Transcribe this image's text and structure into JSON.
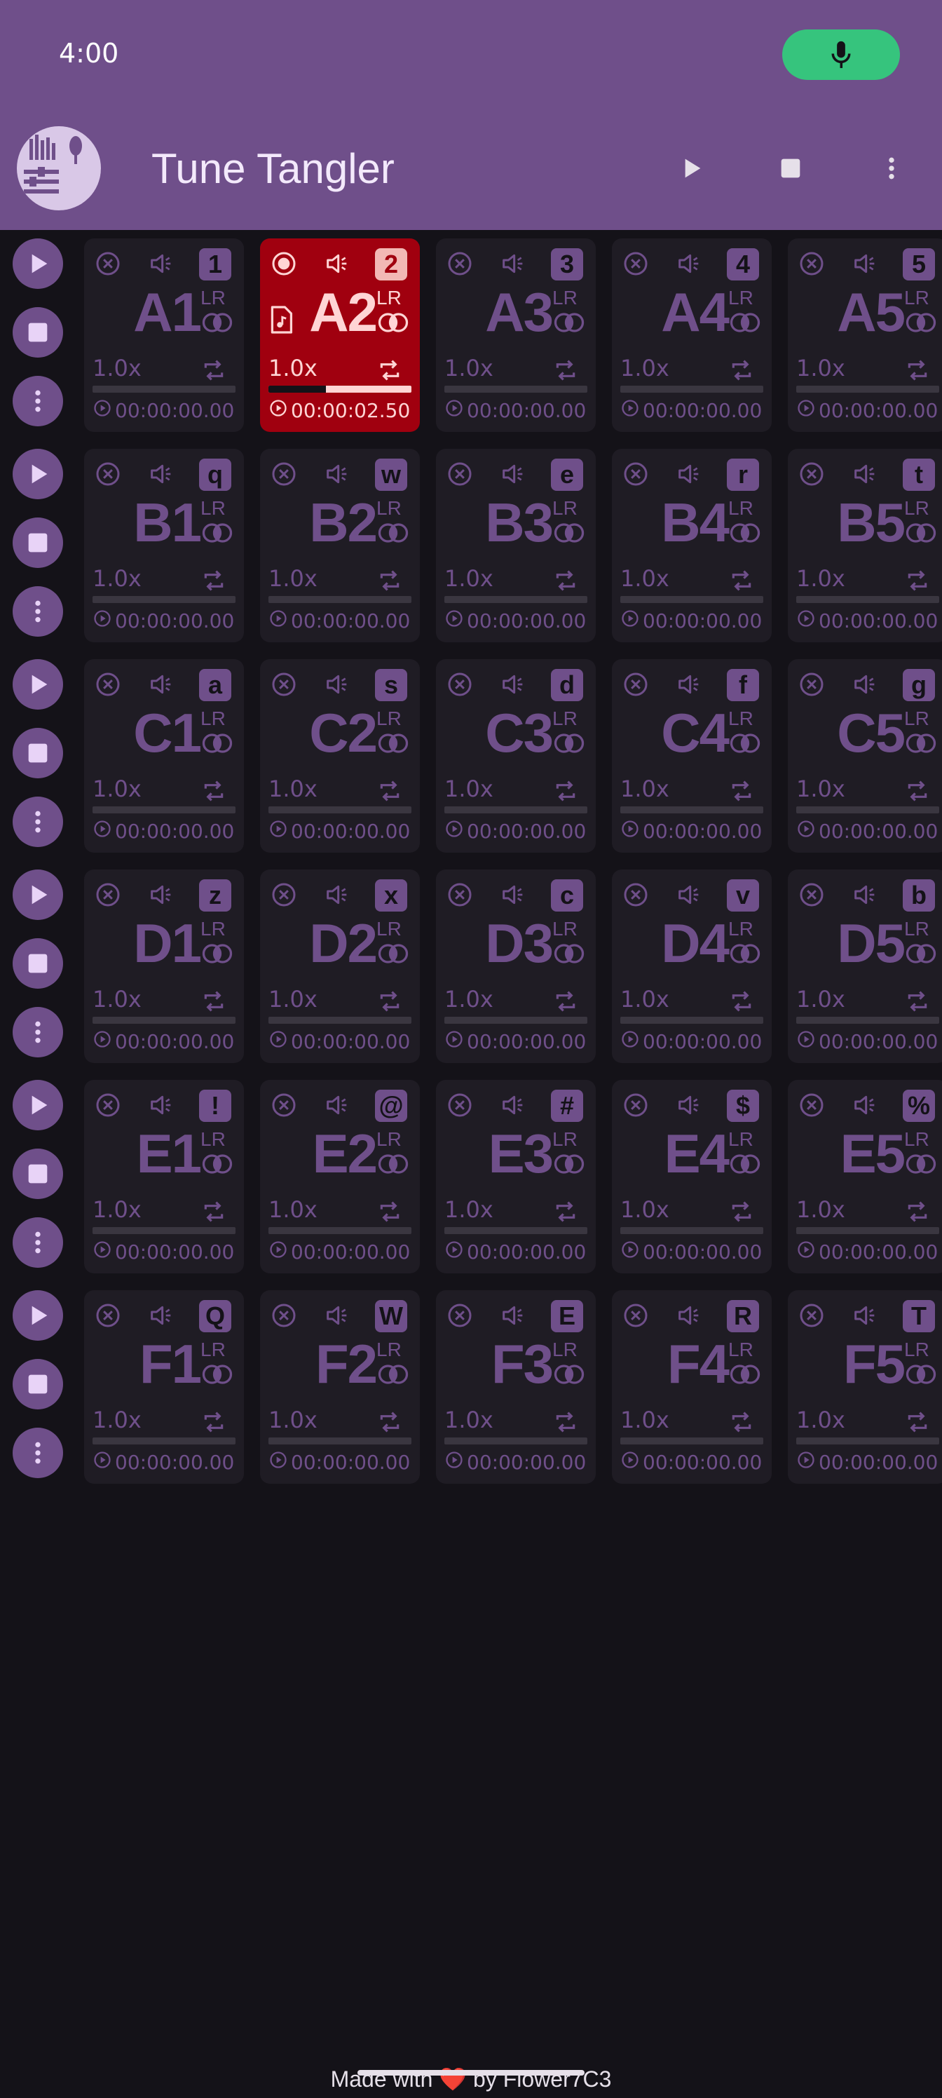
{
  "status": {
    "time": "4:00"
  },
  "app": {
    "title": "Tune Tangler",
    "logo_text": "Tune Tangler"
  },
  "colors": {
    "accent": "#6f4f8a",
    "active_pad": "#a0000f",
    "background": "#141218",
    "mic": "#36c47d"
  },
  "rows": [
    {
      "pads": [
        {
          "name": "A1",
          "key": "1",
          "speed": "1.0x",
          "time": "00:00:00.00",
          "lr": "LR",
          "progress": 0,
          "active": false
        },
        {
          "name": "A2",
          "key": "2",
          "speed": "1.0x",
          "time": "00:00:02.50",
          "lr": "LR",
          "progress": 0.4,
          "active": true
        },
        {
          "name": "A3",
          "key": "3",
          "speed": "1.0x",
          "time": "00:00:00.00",
          "lr": "LR",
          "progress": 0,
          "active": false
        },
        {
          "name": "A4",
          "key": "4",
          "speed": "1.0x",
          "time": "00:00:00.00",
          "lr": "LR",
          "progress": 0,
          "active": false
        },
        {
          "name": "A5",
          "key": "5",
          "speed": "1.0x",
          "time": "00:00:00.00",
          "lr": "LR",
          "progress": 0,
          "active": false
        }
      ]
    },
    {
      "pads": [
        {
          "name": "B1",
          "key": "q",
          "speed": "1.0x",
          "time": "00:00:00.00",
          "lr": "LR",
          "progress": 0,
          "active": false
        },
        {
          "name": "B2",
          "key": "w",
          "speed": "1.0x",
          "time": "00:00:00.00",
          "lr": "LR",
          "progress": 0,
          "active": false
        },
        {
          "name": "B3",
          "key": "e",
          "speed": "1.0x",
          "time": "00:00:00.00",
          "lr": "LR",
          "progress": 0,
          "active": false
        },
        {
          "name": "B4",
          "key": "r",
          "speed": "1.0x",
          "time": "00:00:00.00",
          "lr": "LR",
          "progress": 0,
          "active": false
        },
        {
          "name": "B5",
          "key": "t",
          "speed": "1.0x",
          "time": "00:00:00.00",
          "lr": "LR",
          "progress": 0,
          "active": false
        }
      ]
    },
    {
      "pads": [
        {
          "name": "C1",
          "key": "a",
          "speed": "1.0x",
          "time": "00:00:00.00",
          "lr": "LR",
          "progress": 0,
          "active": false
        },
        {
          "name": "C2",
          "key": "s",
          "speed": "1.0x",
          "time": "00:00:00.00",
          "lr": "LR",
          "progress": 0,
          "active": false
        },
        {
          "name": "C3",
          "key": "d",
          "speed": "1.0x",
          "time": "00:00:00.00",
          "lr": "LR",
          "progress": 0,
          "active": false
        },
        {
          "name": "C4",
          "key": "f",
          "speed": "1.0x",
          "time": "00:00:00.00",
          "lr": "LR",
          "progress": 0,
          "active": false
        },
        {
          "name": "C5",
          "key": "g",
          "speed": "1.0x",
          "time": "00:00:00.00",
          "lr": "LR",
          "progress": 0,
          "active": false
        }
      ]
    },
    {
      "pads": [
        {
          "name": "D1",
          "key": "z",
          "speed": "1.0x",
          "time": "00:00:00.00",
          "lr": "LR",
          "progress": 0,
          "active": false
        },
        {
          "name": "D2",
          "key": "x",
          "speed": "1.0x",
          "time": "00:00:00.00",
          "lr": "LR",
          "progress": 0,
          "active": false
        },
        {
          "name": "D3",
          "key": "c",
          "speed": "1.0x",
          "time": "00:00:00.00",
          "lr": "LR",
          "progress": 0,
          "active": false
        },
        {
          "name": "D4",
          "key": "v",
          "speed": "1.0x",
          "time": "00:00:00.00",
          "lr": "LR",
          "progress": 0,
          "active": false
        },
        {
          "name": "D5",
          "key": "b",
          "speed": "1.0x",
          "time": "00:00:00.00",
          "lr": "LR",
          "progress": 0,
          "active": false
        }
      ]
    },
    {
      "pads": [
        {
          "name": "E1",
          "key": "!",
          "speed": "1.0x",
          "time": "00:00:00.00",
          "lr": "LR",
          "progress": 0,
          "active": false
        },
        {
          "name": "E2",
          "key": "@",
          "speed": "1.0x",
          "time": "00:00:00.00",
          "lr": "LR",
          "progress": 0,
          "active": false
        },
        {
          "name": "E3",
          "key": "#",
          "speed": "1.0x",
          "time": "00:00:00.00",
          "lr": "LR",
          "progress": 0,
          "active": false
        },
        {
          "name": "E4",
          "key": "$",
          "speed": "1.0x",
          "time": "00:00:00.00",
          "lr": "LR",
          "progress": 0,
          "active": false
        },
        {
          "name": "E5",
          "key": "%",
          "speed": "1.0x",
          "time": "00:00:00.00",
          "lr": "LR",
          "progress": 0,
          "active": false
        }
      ]
    },
    {
      "pads": [
        {
          "name": "F1",
          "key": "Q",
          "speed": "1.0x",
          "time": "00:00:00.00",
          "lr": "LR",
          "progress": 0,
          "active": false
        },
        {
          "name": "F2",
          "key": "W",
          "speed": "1.0x",
          "time": "00:00:00.00",
          "lr": "LR",
          "progress": 0,
          "active": false
        },
        {
          "name": "F3",
          "key": "E",
          "speed": "1.0x",
          "time": "00:00:00.00",
          "lr": "LR",
          "progress": 0,
          "active": false
        },
        {
          "name": "F4",
          "key": "R",
          "speed": "1.0x",
          "time": "00:00:00.00",
          "lr": "LR",
          "progress": 0,
          "active": false
        },
        {
          "name": "F5",
          "key": "T",
          "speed": "1.0x",
          "time": "00:00:00.00",
          "lr": "LR",
          "progress": 0,
          "active": false
        }
      ]
    }
  ],
  "footer": {
    "text": "Made with ❤️ by Flower7C3"
  }
}
